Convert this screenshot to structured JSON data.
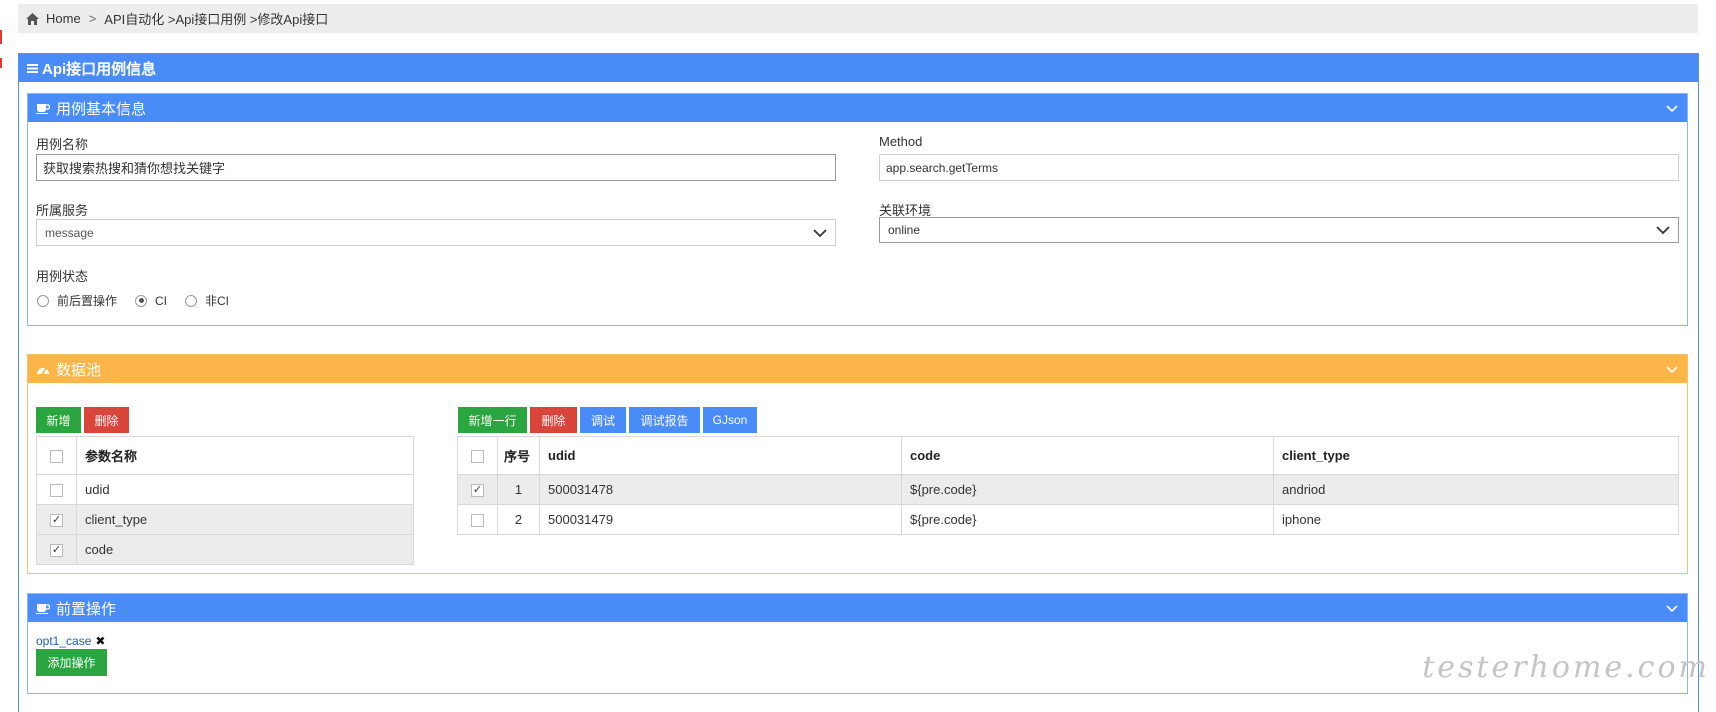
{
  "breadcrumb": {
    "home": "Home",
    "sep": ">",
    "path": "API自动化 >Api接口用例 >修改Api接口"
  },
  "outer_panel": {
    "title": "Api接口用例信息"
  },
  "basic_info": {
    "title": "用例基本信息",
    "name_label": "用例名称",
    "name_value": "获取搜索热搜和猜你想找关键字",
    "method_label": "Method",
    "method_value": "app.search.getTerms",
    "service_label": "所属服务",
    "service_value": "message",
    "env_label": "关联环境",
    "env_value": "online",
    "status_label": "用例状态",
    "status_options": [
      "前后置操作",
      "CI",
      "非CI"
    ],
    "status_selected": "CI"
  },
  "data_pool": {
    "title": "数据池",
    "left_buttons": {
      "add": "新增",
      "delete": "删除"
    },
    "param_table": {
      "header": "参数名称",
      "rows": [
        {
          "name": "udid",
          "checked": false
        },
        {
          "name": "client_type",
          "checked": true
        },
        {
          "name": "code",
          "checked": true
        }
      ]
    },
    "right_buttons": {
      "add_row": "新增一行",
      "delete": "删除",
      "debug": "调试",
      "debug_report": "调试报告",
      "gjson": "GJson"
    },
    "data_table": {
      "headers": [
        "序号",
        "udid",
        "code",
        "client_type"
      ],
      "rows": [
        {
          "checked": true,
          "idx": "1",
          "udid": "500031478",
          "code": "${pre.code}",
          "client_type": "andriod"
        },
        {
          "checked": false,
          "idx": "2",
          "udid": "500031479",
          "code": "${pre.code}",
          "client_type": "iphone"
        }
      ]
    }
  },
  "pre_ops": {
    "title": "前置操作",
    "tag": "opt1_case",
    "tag_remove": "✖",
    "add_button": "添加操作"
  },
  "watermark": "testerhome.com",
  "colors": {
    "blue": "#4a8cf7",
    "orange": "#fdb54a",
    "green": "#2aa53f",
    "red": "#d9453b"
  }
}
